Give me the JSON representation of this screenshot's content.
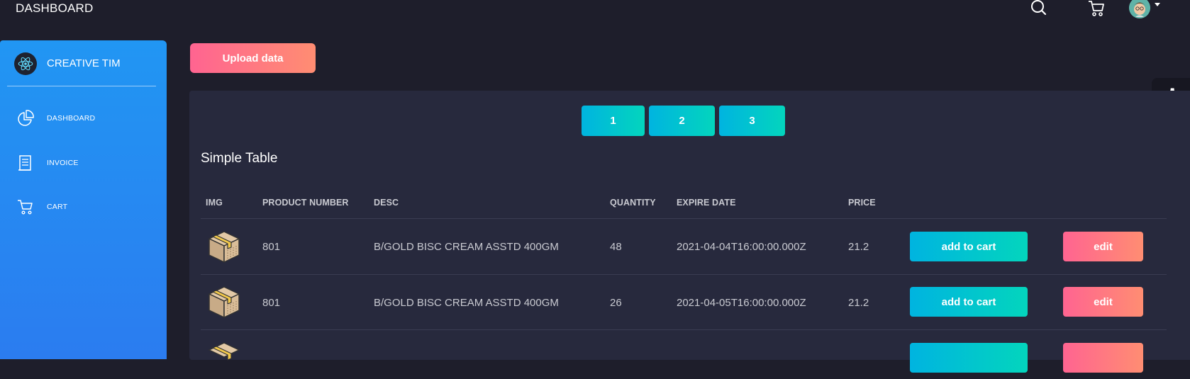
{
  "navbar": {
    "title": "DASHBOARD",
    "icons": [
      "search-icon",
      "cart-icon",
      "avatar"
    ]
  },
  "sidebar": {
    "logo_icon": "react-atom-icon",
    "title": "CREATIVE TIM",
    "items": [
      {
        "label": "DASHBOARD",
        "icon": "pie-chart-icon"
      },
      {
        "label": "INVOICE",
        "icon": "document-icon"
      },
      {
        "label": "CART",
        "icon": "cart-icon"
      }
    ]
  },
  "toolbar": {
    "upload_label": "Upload data"
  },
  "pagination": {
    "pages": [
      "1",
      "2",
      "3"
    ]
  },
  "table": {
    "title": "Simple Table",
    "headers": [
      "IMG",
      "PRODUCT NUMBER",
      "DESC",
      "QUANTITY",
      "EXPIRE DATE",
      "PRICE"
    ],
    "rows": [
      {
        "img": "box-icon",
        "product_number": "801",
        "desc": "B/GOLD BISC CREAM ASSTD 400GM",
        "quantity": "48",
        "expire_date": "2021-04-04T16:00:00.000Z",
        "price": "21.2",
        "cart_label": "add to cart",
        "edit_label": "edit"
      },
      {
        "img": "box-icon",
        "product_number": "801",
        "desc": "B/GOLD BISC CREAM ASSTD 400GM",
        "quantity": "26",
        "expire_date": "2021-04-05T16:00:00.000Z",
        "price": "21.2",
        "cart_label": "add to cart",
        "edit_label": "edit"
      },
      {
        "img": "box-icon",
        "cart_label": "",
        "edit_label": ""
      }
    ]
  },
  "colors": {
    "background": "#1e1e2b",
    "card": "#27293d",
    "sidebar_blue": "#2196f3",
    "primary_gradient_start": "#ff6491",
    "primary_gradient_end": "#ff8d72",
    "info_gradient_start": "#00b4e0",
    "info_gradient_end": "#03d5bd"
  }
}
